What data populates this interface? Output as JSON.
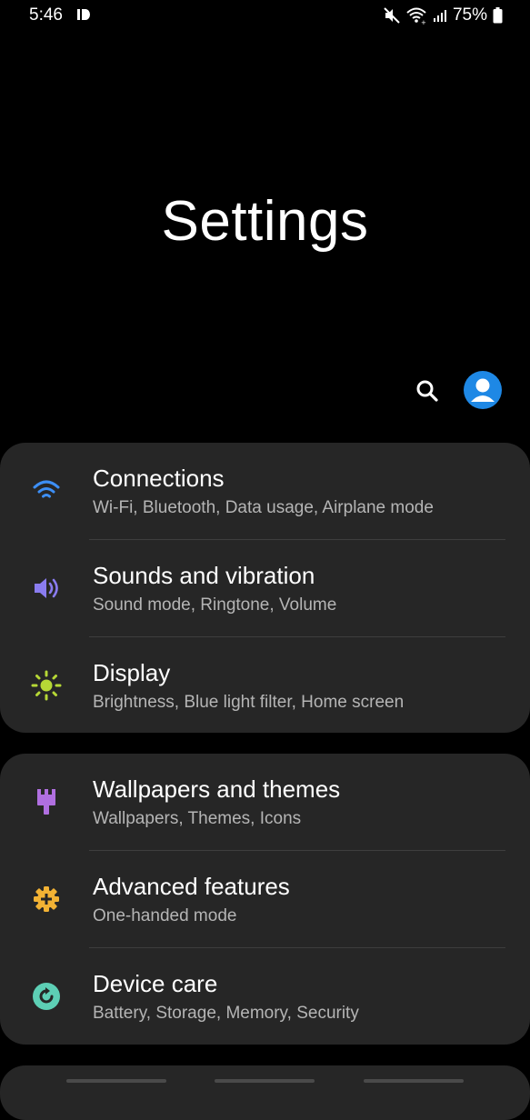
{
  "status_bar": {
    "time": "5:46",
    "battery_percent": "75%",
    "icons": [
      "id-icon",
      "mute-icon",
      "wifi-calling-icon",
      "signal-icon",
      "battery-icon"
    ]
  },
  "header": {
    "title": "Settings"
  },
  "actions": {
    "search_icon": "search-icon",
    "account_icon": "account-icon"
  },
  "colors": {
    "background": "#000000",
    "card": "#262626",
    "connections_icon": "#3d8ff5",
    "sounds_icon": "#8a7cf0",
    "display_icon": "#b6d836",
    "wallpapers_icon": "#b06fe0",
    "advanced_icon": "#f2b234",
    "device_care_icon": "#5dcfb5",
    "account_bg": "#1e88e5"
  },
  "groups": [
    {
      "items": [
        {
          "title": "Connections",
          "subtitle": "Wi-Fi, Bluetooth, Data usage, Airplane mode",
          "icon": "wifi-icon"
        },
        {
          "title": "Sounds and vibration",
          "subtitle": "Sound mode, Ringtone, Volume",
          "icon": "speaker-icon"
        },
        {
          "title": "Display",
          "subtitle": "Brightness, Blue light filter, Home screen",
          "icon": "sun-icon"
        }
      ]
    },
    {
      "items": [
        {
          "title": "Wallpapers and themes",
          "subtitle": "Wallpapers, Themes, Icons",
          "icon": "paintbrush-icon"
        },
        {
          "title": "Advanced features",
          "subtitle": "One-handed mode",
          "icon": "gear-plus-icon"
        },
        {
          "title": "Device care",
          "subtitle": "Battery, Storage, Memory, Security",
          "icon": "refresh-icon"
        }
      ]
    }
  ]
}
